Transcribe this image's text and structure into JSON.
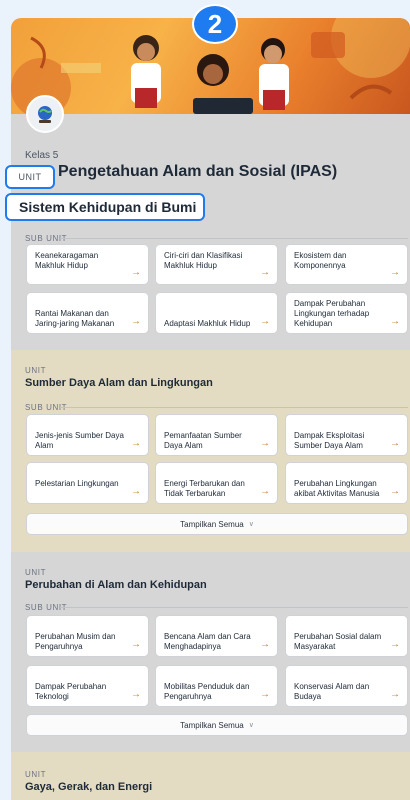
{
  "step_badge": "2",
  "course": {
    "grade": "Kelas 5",
    "subject": "Pengetahuan Alam dan Sosial (IPAS)"
  },
  "labels": {
    "unit": "UNIT",
    "sub_unit": "SUB UNIT",
    "show_all": "Tampilkan Semua"
  },
  "units": [
    {
      "title": "Sistem Kehidupan di Bumi",
      "sub_units": [
        "Keanekaragaman Makhluk Hidup",
        "Ciri-ciri dan Klasifikasi Makhluk Hidup",
        "Ekosistem dan Komponennya",
        "Rantai Makanan dan Jaring-jaring Makanan",
        "Adaptasi Makhluk Hidup",
        "Dampak Perubahan Lingkungan terhadap Kehidupan"
      ]
    },
    {
      "title": "Sumber Daya Alam dan Lingkungan",
      "sub_units": [
        "Jenis-jenis Sumber Daya Alam",
        "Pemanfaatan Sumber Daya Alam",
        "Dampak Eksploitasi Sumber Daya Alam",
        "Pelestarian Lingkungan",
        "Energi Terbarukan dan Tidak Terbarukan",
        "Perubahan Lingkungan akibat Aktivitas Manusia"
      ]
    },
    {
      "title": "Perubahan di Alam dan Kehidupan",
      "sub_units": [
        "Perubahan Musim dan Pengaruhnya",
        "Bencana Alam dan Cara Menghadapinya",
        "Perubahan Sosial dalam Masyarakat",
        "Dampak Perubahan Teknologi",
        "Mobilitas Penduduk dan Pengaruhnya",
        "Konservasi Alam dan Budaya"
      ]
    },
    {
      "title": "Gaya, Gerak, dan Energi",
      "sub_units": []
    }
  ],
  "icons": {
    "arrow": "arrow-right-icon",
    "chevron": "chevron-down-icon",
    "logo": "globe-plant-icon"
  },
  "colors": {
    "accent": "#1e7bf0",
    "highlight_section": "#e4dcc2",
    "arrow": "#c07a20"
  }
}
